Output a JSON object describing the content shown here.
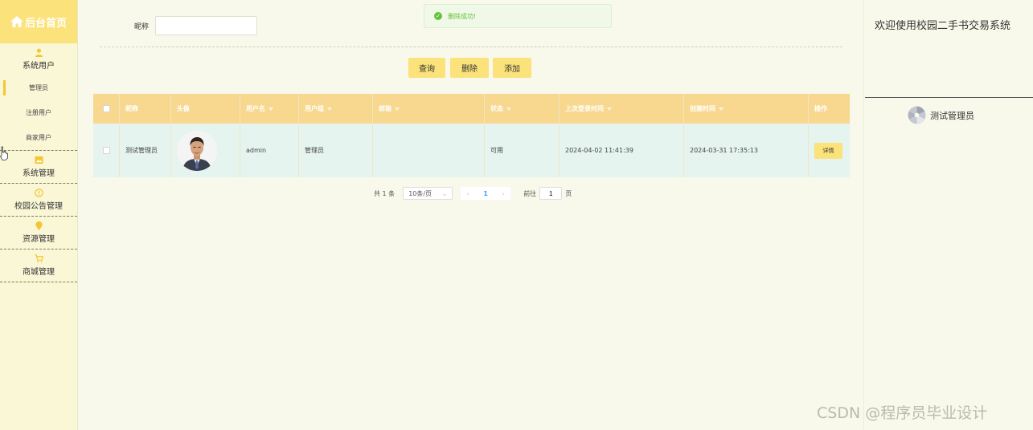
{
  "brand": {
    "title": "后台首页"
  },
  "sidebar": {
    "groups": [
      {
        "label": "系统用户",
        "icon": "user-icon",
        "items": [
          {
            "label": "管理员",
            "active": true
          },
          {
            "label": "注册用户"
          },
          {
            "label": "商家用户"
          }
        ]
      },
      {
        "label": "系统管理",
        "icon": "image-icon"
      },
      {
        "label": "校园公告管理",
        "icon": "info-icon"
      },
      {
        "label": "资源管理",
        "icon": "location-icon"
      },
      {
        "label": "商城管理",
        "icon": "cart-icon"
      }
    ]
  },
  "toast": {
    "message": "删除成功!",
    "icon": "check-circle-icon",
    "color": "#67c23a"
  },
  "search": {
    "label": "昵称",
    "value": "",
    "placeholder": ""
  },
  "buttons": {
    "query": "查询",
    "delete": "删除",
    "add": "添加"
  },
  "table": {
    "headers": {
      "nickname": "昵称",
      "avatar": "头像",
      "username": "用户名",
      "group": "用户组",
      "email": "邮箱",
      "status": "状态",
      "last_login": "上次登录时间",
      "created": "创建时间",
      "actions": "操作"
    },
    "rows": [
      {
        "nickname": "测试管理员",
        "username": "admin",
        "group": "管理员",
        "email": "",
        "status": "可用",
        "last_login": "2024-04-02 11:41:39",
        "created": "2024-03-31 17:35:13",
        "action": "详情"
      }
    ]
  },
  "pagination": {
    "total": "共 1 条",
    "page_size": "10条/页",
    "current_page": "1",
    "goto_label": "前往",
    "goto_value": "1",
    "page_unit": "页"
  },
  "right_panel": {
    "welcome": "欢迎使用校园二手书交易系统",
    "user_name": "测试管理员"
  },
  "watermark": "CSDN @程序员毕业设计",
  "colors": {
    "accent": "#fbe27a",
    "header": "#f7d88e",
    "row": "#e5f4ee",
    "background": "#f8f9ea",
    "sidebar": "#faf7d6"
  }
}
